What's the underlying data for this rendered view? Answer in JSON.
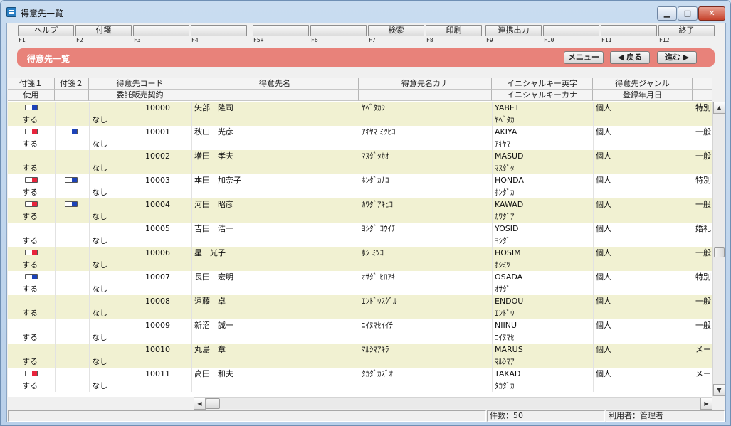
{
  "window": {
    "title": "得意先一覧",
    "min_label": "▁",
    "max_label": "□",
    "close_label": "✕"
  },
  "fkeys": [
    {
      "label": "ヘルプ",
      "key": "F1"
    },
    {
      "label": "付箋",
      "key": "F2"
    },
    {
      "label": "",
      "key": "F3"
    },
    {
      "label": "",
      "key": "F4"
    },
    {
      "label": "",
      "key": "F5+"
    },
    {
      "label": "",
      "key": "F6"
    },
    {
      "label": "検索",
      "key": "F7"
    },
    {
      "label": "印刷",
      "key": "F8"
    },
    {
      "label": "連携出力",
      "key": "F9"
    },
    {
      "label": "",
      "key": "F10"
    },
    {
      "label": "",
      "key": "F11"
    },
    {
      "label": "終了",
      "key": "F12"
    }
  ],
  "banner": {
    "title": "得意先一覧",
    "menu_label": "メニュー",
    "back_label": "◀ 戻る",
    "forward_label": "進む ▶"
  },
  "columns": {
    "row1": [
      "付箋１",
      "付箋２",
      "得意先コード",
      "得意先名",
      "得意先名カナ",
      "イニシャルキー英字",
      "得意先ジャンル"
    ],
    "row2": [
      "使用",
      "",
      "委託販売契約",
      "",
      "",
      "イニシャルキーカナ",
      "登録年月日"
    ]
  },
  "rows": [
    {
      "tag1": "blue",
      "tag2": "",
      "code": "10000",
      "name": "矢部　隆司",
      "kana": "ﾔﾍﾞﾀｶｼ",
      "initial": "YABET",
      "initial_kana": "ﾔﾍﾞﾀｶ",
      "genre": "個人",
      "extra": "特別",
      "use": "する",
      "consign": "なし"
    },
    {
      "tag1": "red",
      "tag2": "blue",
      "code": "10001",
      "name": "秋山　光彦",
      "kana": "ｱｷﾔﾏ ﾐﾂﾋｺ",
      "initial": "AKIYA",
      "initial_kana": "ｱｷﾔﾏ",
      "genre": "個人",
      "extra": "一般",
      "use": "する",
      "consign": "なし"
    },
    {
      "tag1": "",
      "tag2": "",
      "code": "10002",
      "name": "増田　孝夫",
      "kana": "ﾏｽﾀﾞﾀｶｵ",
      "initial": "MASUD",
      "initial_kana": "ﾏｽﾀﾞﾀ",
      "genre": "個人",
      "extra": "一般",
      "use": "する",
      "consign": "なし"
    },
    {
      "tag1": "red",
      "tag2": "blue",
      "code": "10003",
      "name": "本田　加奈子",
      "kana": "ﾎﾝﾀﾞｶﾅｺ",
      "initial": "HONDA",
      "initial_kana": "ﾎﾝﾀﾞｶ",
      "genre": "個人",
      "extra": "特別",
      "use": "する",
      "consign": "なし"
    },
    {
      "tag1": "red",
      "tag2": "blue",
      "code": "10004",
      "name": "河田　昭彦",
      "kana": "ｶﾜﾀﾞｱｷﾋｺ",
      "initial": "KAWAD",
      "initial_kana": "ｶﾜﾀﾞｱ",
      "genre": "個人",
      "extra": "一般",
      "use": "する",
      "consign": "なし"
    },
    {
      "tag1": "",
      "tag2": "",
      "code": "10005",
      "name": "吉田　浩一",
      "kana": "ﾖｼﾀﾞ ｺｳｲﾁ",
      "initial": "YOSID",
      "initial_kana": "ﾖｼﾀﾞ",
      "genre": "個人",
      "extra": "婚礼",
      "use": "する",
      "consign": "なし"
    },
    {
      "tag1": "red",
      "tag2": "",
      "code": "10006",
      "name": "星　光子",
      "kana": "ﾎｼ ﾐﾂｺ",
      "initial": "HOSIM",
      "initial_kana": "ﾎｼﾐﾂ",
      "genre": "個人",
      "extra": "一般",
      "use": "する",
      "consign": "なし"
    },
    {
      "tag1": "blue",
      "tag2": "",
      "code": "10007",
      "name": "長田　宏明",
      "kana": "ｵｻﾀﾞ ﾋﾛｱｷ",
      "initial": "OSADA",
      "initial_kana": "ｵｻﾀﾞ",
      "genre": "個人",
      "extra": "特別",
      "use": "する",
      "consign": "なし"
    },
    {
      "tag1": "",
      "tag2": "",
      "code": "10008",
      "name": "遠藤　卓",
      "kana": "ｴﾝﾄﾞｳｽｸﾞﾙ",
      "initial": "ENDOU",
      "initial_kana": "ｴﾝﾄﾞｳ",
      "genre": "個人",
      "extra": "一般",
      "use": "する",
      "consign": "なし"
    },
    {
      "tag1": "",
      "tag2": "",
      "code": "10009",
      "name": "新沼　誠一",
      "kana": "ﾆｲﾇﾏｾｲｲﾁ",
      "initial": "NIINU",
      "initial_kana": "ﾆｲﾇﾏｾ",
      "genre": "個人",
      "extra": "一般",
      "use": "する",
      "consign": "なし"
    },
    {
      "tag1": "",
      "tag2": "",
      "code": "10010",
      "name": "丸島　章",
      "kana": "ﾏﾙｼﾏｱｷﾗ",
      "initial": "MARUS",
      "initial_kana": "ﾏﾙｼﾏｱ",
      "genre": "個人",
      "extra": "メー",
      "use": "する",
      "consign": "なし"
    },
    {
      "tag1": "red",
      "tag2": "",
      "code": "10011",
      "name": "高田　和夫",
      "kana": "ﾀｶﾀﾞｶｽﾞｵ",
      "initial": "TAKAD",
      "initial_kana": "ﾀｶﾀﾞｶ",
      "genre": "個人",
      "extra": "メー",
      "use": "する",
      "consign": "なし"
    }
  ],
  "status": {
    "count": "件数：50",
    "user": "利用者：管理者"
  },
  "colors": {
    "banner": "#e8827a",
    "row_tint": "#f1f1d2",
    "tag_red": "#e8243c",
    "tag_blue": "#1d43b8"
  }
}
